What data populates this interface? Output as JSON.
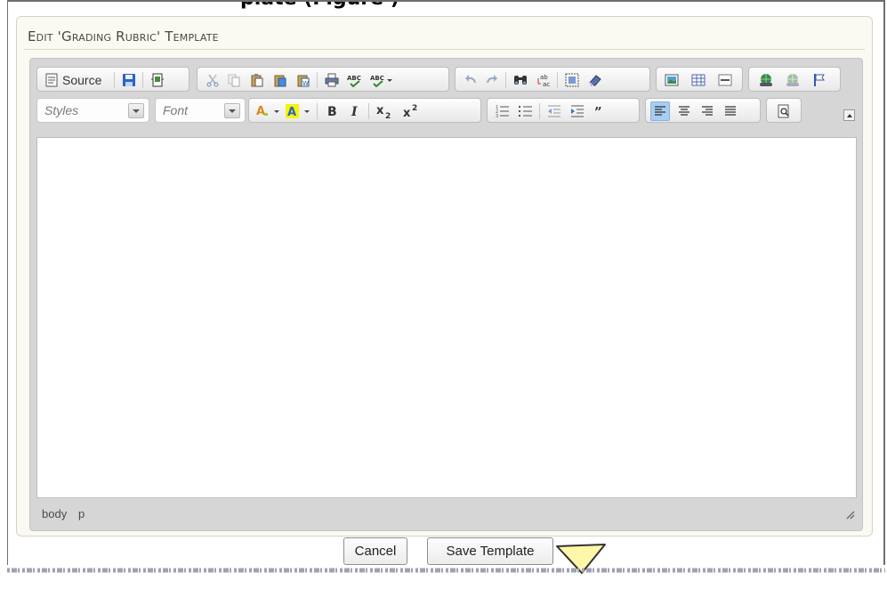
{
  "page": {
    "heading": "plate (Figure )"
  },
  "dialog": {
    "title": "Edit 'Grading Rubric' Template"
  },
  "toolbar": {
    "source_label": "Source",
    "styles_label": "Styles",
    "font_label": "Font",
    "row1_icons": [
      "source-icon",
      "save-icon",
      "templates-icon",
      "cut-icon",
      "copy-icon",
      "paste-icon",
      "paste-text-icon",
      "paste-word-icon",
      "print-icon",
      "spellcheck-icon",
      "spellcheck-menu-icon",
      "undo-icon",
      "redo-icon",
      "find-icon",
      "replace-icon",
      "select-all-icon",
      "remove-format-icon",
      "image-icon",
      "table-icon",
      "horizontal-rule-icon",
      "link-icon",
      "unlink-icon",
      "anchor-icon"
    ],
    "row2_icons": [
      "text-color-icon",
      "background-color-icon",
      "bold-icon",
      "italic-icon",
      "subscript-icon",
      "superscript-icon",
      "numbered-list-icon",
      "bulleted-list-icon",
      "outdent-icon",
      "indent-icon",
      "blockquote-icon",
      "align-left-icon",
      "align-center-icon",
      "align-right-icon",
      "align-justify-icon",
      "preview-icon"
    ],
    "active_align": "align-left"
  },
  "editor": {
    "path": [
      "body",
      "p"
    ]
  },
  "actions": {
    "cancel_label": "Cancel",
    "save_label": "Save Template"
  },
  "colors": {
    "accent": "#a9cdf0",
    "dialog_bg": "#fbfaf2",
    "toolbar_bg": "#d6d6d6",
    "pointer": "#fff7a8"
  }
}
